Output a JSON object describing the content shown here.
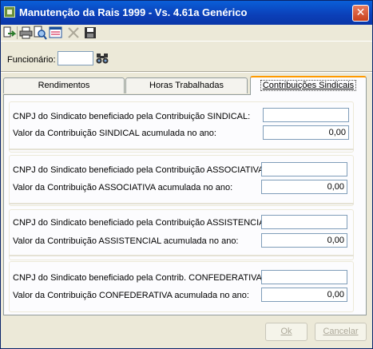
{
  "window": {
    "title": "Manutenção da Rais 1999 - Vs. 4.61a Genérico",
    "close_symbol": "✕"
  },
  "toolbar": [
    "import-icon",
    "print-icon",
    "preview-icon",
    "list-icon",
    "delete-icon",
    "save-icon"
  ],
  "funcionario": {
    "label": "Funcionário:",
    "value": ""
  },
  "tabs": [
    {
      "label": "Rendimentos",
      "active": false
    },
    {
      "label": "Horas Trabalhadas",
      "active": false
    },
    {
      "label": "Contribuições Sindicais",
      "active": true
    }
  ],
  "contribuicoes": [
    {
      "cnpj_label": "CNPJ do Sindicato beneficiado pela Contribuição SINDICAL:",
      "cnpj_value": "",
      "valor_label": "Valor da Contribuição SINDICAL acumulada no ano:",
      "valor": "0,00"
    },
    {
      "cnpj_label": "CNPJ do Sindicato beneficiado pela Contribuição ASSOCIATIVA:",
      "cnpj_value": "",
      "valor_label": "Valor da Contribuição ASSOCIATIVA acumulada no ano:",
      "valor": "0,00"
    },
    {
      "cnpj_label": "CNPJ do Sindicato beneficiado pela Contribuição ASSISTENCIAL:",
      "cnpj_value": "",
      "valor_label": "Valor da Contribuição ASSISTENCIAL acumulada no ano:",
      "valor": "0,00"
    },
    {
      "cnpj_label": "CNPJ do Sindicato beneficiado pela Contrib. CONFEDERATIVA:",
      "cnpj_value": "",
      "valor_label": "Valor da Contribuição CONFEDERATIVA acumulada no ano:",
      "valor": "0,00"
    }
  ],
  "buttons": {
    "ok": "Ok",
    "cancel": "Cancelar"
  }
}
